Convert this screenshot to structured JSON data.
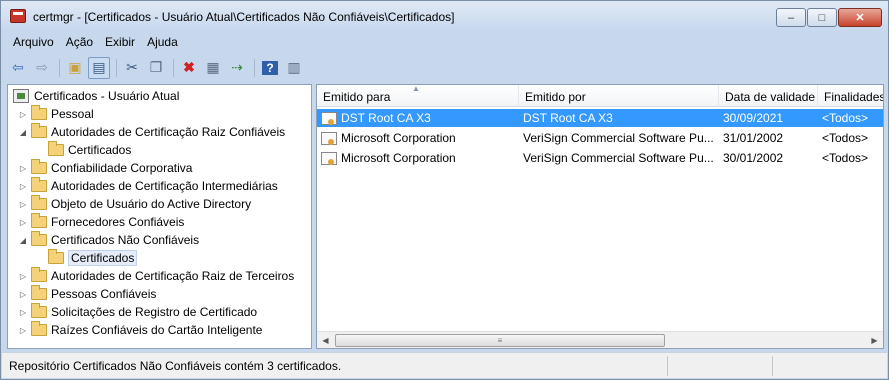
{
  "window": {
    "title": "certmgr - [Certificados - Usuário Atual\\Certificados Não Confiáveis\\Certificados]",
    "controls": {
      "minimize": "–",
      "maximize": "□",
      "close": "✕"
    }
  },
  "menu": [
    "Arquivo",
    "Ação",
    "Exibir",
    "Ajuda"
  ],
  "toolbar": {
    "icons": [
      "back-arrow-icon",
      "forward-arrow-icon",
      "up-folder-icon",
      "show-hide-tree-icon",
      "cut-icon",
      "copy-icon",
      "delete-icon",
      "properties-icon",
      "export-list-icon",
      "help-icon",
      "view-icon"
    ]
  },
  "tree": {
    "root": "Certificados - Usuário Atual",
    "items": [
      {
        "label": "Pessoal"
      },
      {
        "label": "Autoridades de Certificação Raiz Confiáveis"
      },
      {
        "label": "Certificados"
      },
      {
        "label": "Confiabilidade Corporativa"
      },
      {
        "label": "Autoridades de Certificação Intermediárias"
      },
      {
        "label": "Objeto de Usuário do Active Directory"
      },
      {
        "label": "Fornecedores Confiáveis"
      },
      {
        "label": "Certificados Não Confiáveis"
      },
      {
        "label": "Certificados"
      },
      {
        "label": "Autoridades de Certificação Raiz de Terceiros"
      },
      {
        "label": "Pessoas Confiáveis"
      },
      {
        "label": "Solicitações de Registro de Certificado"
      },
      {
        "label": "Raízes Confiáveis do Cartão Inteligente"
      }
    ]
  },
  "list": {
    "columns": [
      "Emitido para",
      "Emitido por",
      "Data de validade",
      "Finalidades"
    ],
    "rows": [
      {
        "issued_to": "DST Root CA X3",
        "issued_by": "DST Root CA X3",
        "expiry": "30/09/2021",
        "purposes": "<Todos>"
      },
      {
        "issued_to": "Microsoft Corporation",
        "issued_by": "VeriSign Commercial Software Pu...",
        "expiry": "31/01/2002",
        "purposes": "<Todos>"
      },
      {
        "issued_to": "Microsoft Corporation",
        "issued_by": "VeriSign Commercial Software Pu...",
        "expiry": "30/01/2002",
        "purposes": "<Todos>"
      }
    ]
  },
  "status": {
    "text": "Repositório Certificados Não Confiáveis contém 3 certificados."
  },
  "colors": {
    "selection": "#3399ff",
    "frame": "#c7d8ed"
  }
}
